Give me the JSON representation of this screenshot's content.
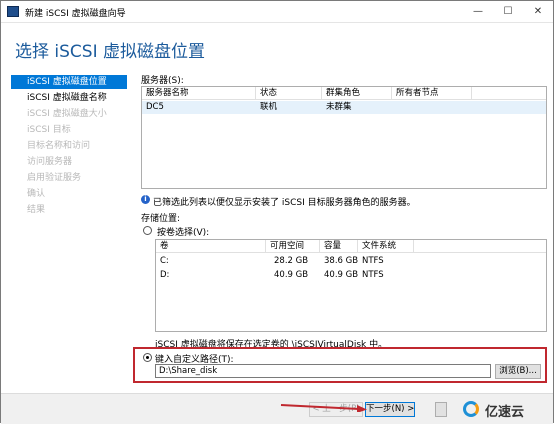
{
  "window": {
    "title": "新建 iSCSI 虚拟磁盘向导",
    "minimize": "—",
    "maximize": "☐",
    "close": "✕"
  },
  "header": {
    "title": "选择 iSCSI 虚拟磁盘位置"
  },
  "nav": {
    "items": [
      {
        "label": "iSCSI 虚拟磁盘位置",
        "state": "active"
      },
      {
        "label": "iSCSI 虚拟磁盘名称",
        "state": "normal"
      },
      {
        "label": "iSCSI 虚拟磁盘大小",
        "state": "disabled"
      },
      {
        "label": "iSCSI 目标",
        "state": "disabled"
      },
      {
        "label": "目标名称和访问",
        "state": "disabled"
      },
      {
        "label": "访问服务器",
        "state": "disabled"
      },
      {
        "label": "启用验证服务",
        "state": "disabled"
      },
      {
        "label": "确认",
        "state": "disabled"
      },
      {
        "label": "结果",
        "state": "disabled"
      }
    ]
  },
  "servers": {
    "label": "服务器(S):",
    "columns": [
      "服务器名称",
      "状态",
      "群集角色",
      "所有者节点"
    ],
    "rows": [
      [
        "DC5",
        "联机",
        "未群集",
        ""
      ]
    ]
  },
  "info_text": "已筛选此列表以便仅显示安装了 iSCSI 目标服务器角色的服务器。",
  "storage": {
    "label": "存储位置:",
    "by_volume_label": "按卷选择(V):",
    "volume_columns": [
      "卷",
      "可用空间",
      "容量",
      "文件系统"
    ],
    "volumes": [
      [
        "C:",
        "28.2 GB",
        "38.6 GB",
        "NTFS"
      ],
      [
        "D:",
        "40.9 GB",
        "40.9 GB",
        "NTFS"
      ]
    ],
    "volume_note": "iSCSI 虚拟磁盘将保存在选定卷的 \\iSCSIVirtualDisk 中。",
    "custom_path_label": "键入自定义路径(T):",
    "custom_path_value": "D:\\Share_disk",
    "browse_label": "浏览(B)..."
  },
  "footer": {
    "prev_label": "< 上一步(P)",
    "next_label": "下一步(N) >"
  },
  "colors": {
    "accent": "#0078d7",
    "header": "#1c5b9c",
    "highlight": "#c0282f"
  }
}
